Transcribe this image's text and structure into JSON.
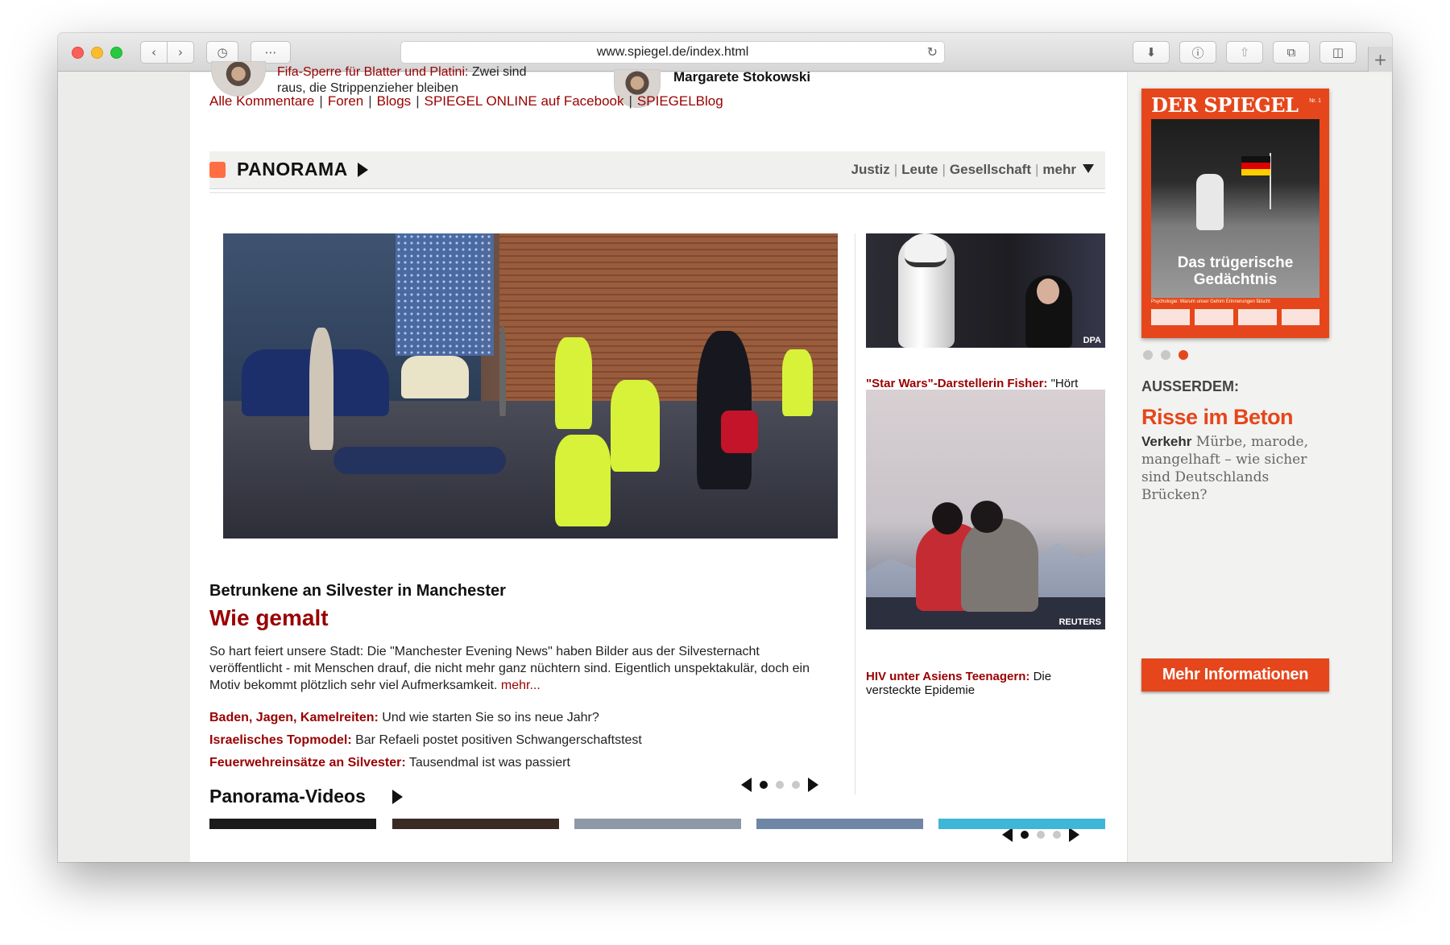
{
  "browser": {
    "url": "www.spiegel.de/index.html",
    "icons": [
      "back-icon",
      "forward-icon",
      "history-icon",
      "grid-icon",
      "reload-icon",
      "download-icon",
      "onepassword-icon",
      "share-icon",
      "tabs-icon",
      "sidebar-icon",
      "plus-icon"
    ]
  },
  "top": {
    "snippet_red": "Fifa-Sperre für Blatter und Platini:",
    "snippet_rest": "Zwei sind",
    "snippet_line2": "raus, die Strippenzieher bleiben",
    "author": "Margarete Stokowski"
  },
  "footlinks": [
    "Alle Kommentare",
    "Foren",
    "Blogs",
    "SPIEGEL ONLINE auf Facebook",
    "SPIEGELBlog"
  ],
  "section": {
    "title": "PANORAMA",
    "nav": [
      "Justiz",
      "Leute",
      "Gesellschaft",
      "mehr"
    ]
  },
  "lead": {
    "kicker": "Betrunkene an Silvester in Manchester",
    "title": "Wie gemalt",
    "text": "So hart feiert unsere Stadt: Die \"Manchester Evening News\" haben Bilder aus der Silvesternacht veröffentlicht - mit Menschen drauf, die nicht mehr ganz nüchtern sind. Eigentlich unspektakulär, doch ein Motiv bekommt plötzlich sehr viel Aufmerksamkeit.",
    "more": "mehr...",
    "related": [
      {
        "head": "Baden, Jagen, Kamelreiten:",
        "text": "Und wie starten Sie so ins neue Jahr?"
      },
      {
        "head": "Israelisches Topmodel:",
        "text": "Bar Refaeli postet positiven Schwangerschaftstest"
      },
      {
        "head": "Feuerwehreinsätze an Silvester:",
        "text": "Tausendmal ist was passiert"
      }
    ]
  },
  "side": [
    {
      "credit": "DPA",
      "head": "\"Star Wars\"-Darstellerin Fisher:",
      "text": "\"Hört auf, darüber zu debattieren, ob ich gut gealtert bin\""
    },
    {
      "credit": "REUTERS",
      "head": "HIV unter Asiens Teenagern:",
      "text": "Die versteckte Epidemie"
    }
  ],
  "videos": {
    "title": "Panorama-Videos"
  },
  "magazine": {
    "masthead": "DER SPIEGEL",
    "issue": "Nr. 1",
    "cover_headline": "Das trügerische Gedächtnis",
    "cover_sub": "Psychologie: Warum unser Gehirn Erinnerungen fälscht",
    "ausserdem": "AUSSERDEM:",
    "story_title": "Risse im Beton",
    "story_kicker": "Verkehr",
    "story_text": "Mürbe, marode, mangelhaft – wie sicher sind Deutschlands Brücken?",
    "button": "Mehr Informationen",
    "accent": "#e6461b"
  },
  "colors": {
    "link_red": "#990000",
    "section_square": "#ff6e42"
  }
}
